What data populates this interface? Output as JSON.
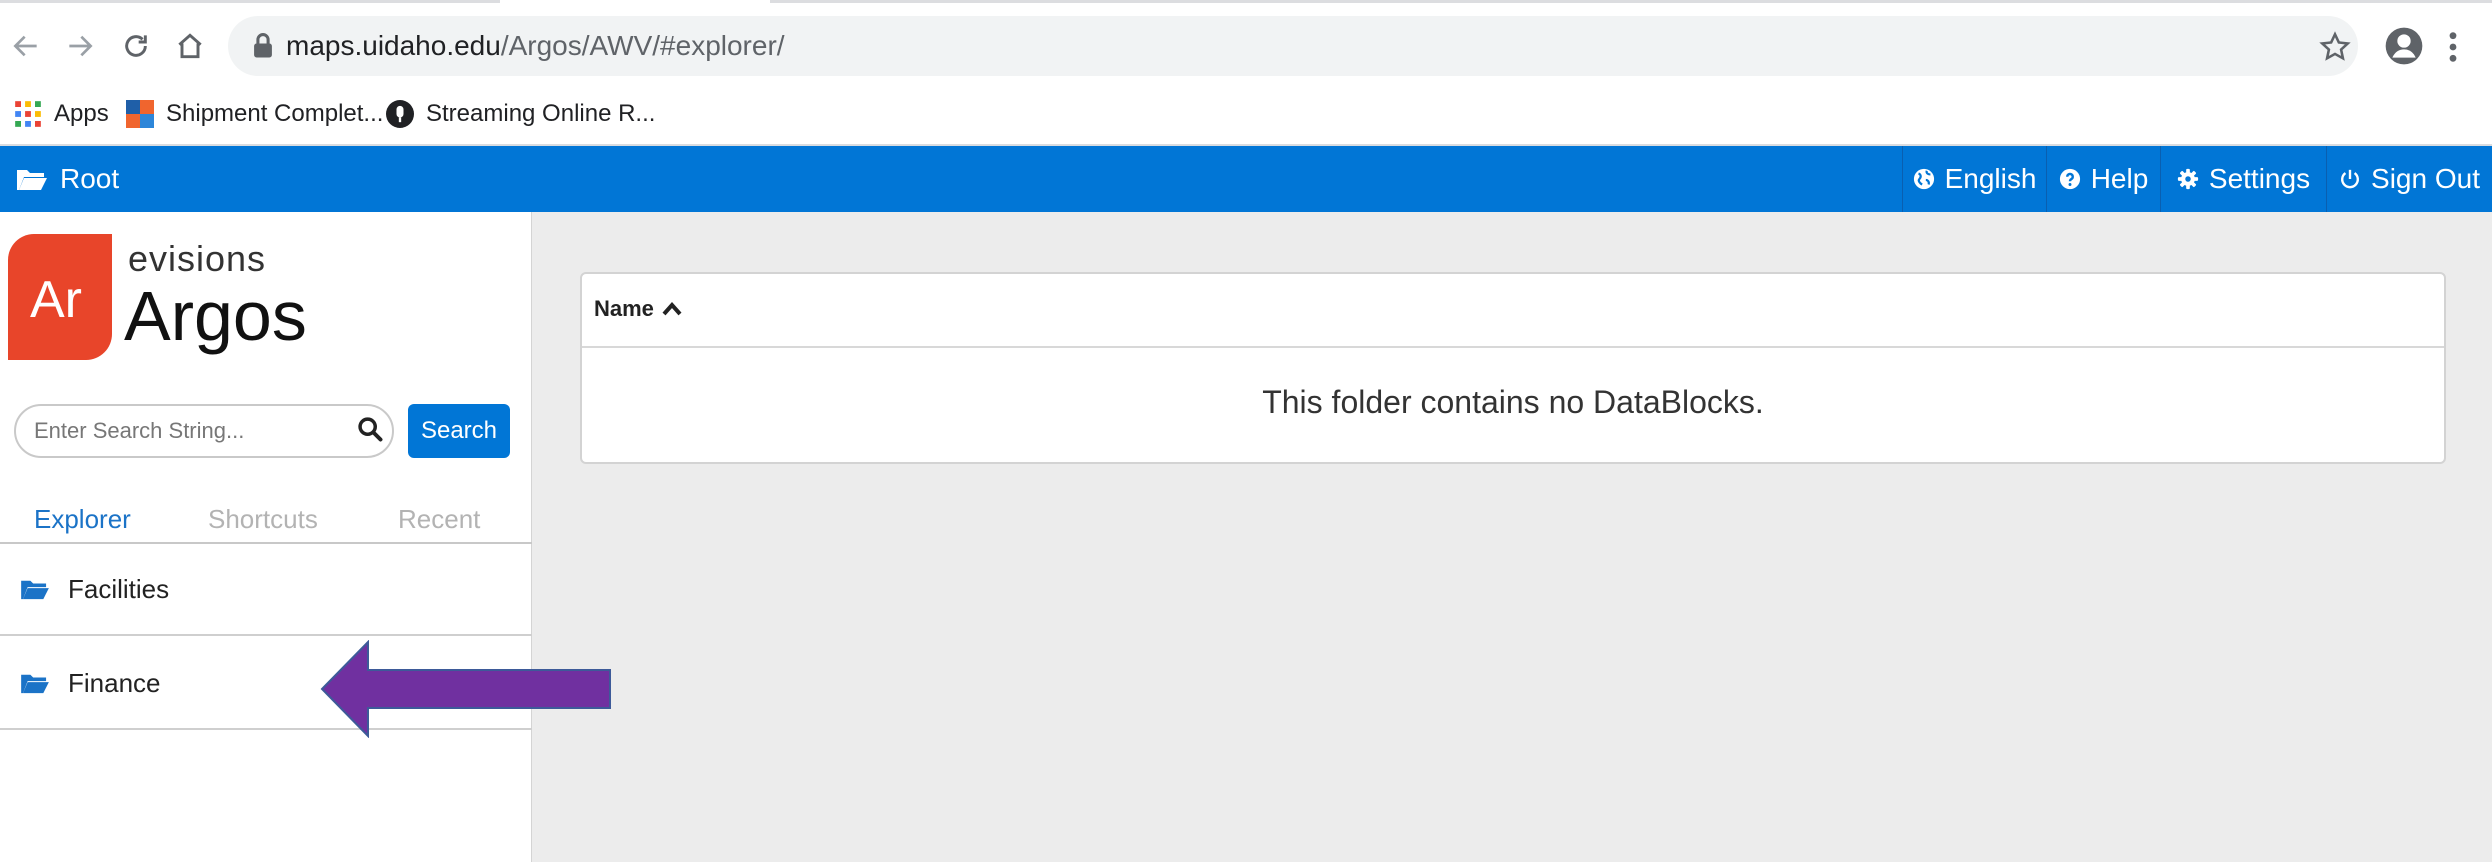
{
  "browser": {
    "url_host": "maps.uidaho.edu",
    "url_path": "/Argos/AWV/#explorer/",
    "bookmarks": [
      {
        "label": "Apps",
        "icon": "apps-grid-icon"
      },
      {
        "label": "Shipment Complet...",
        "icon": "shipment-site-icon"
      },
      {
        "label": "Streaming Online R...",
        "icon": "microphone-site-icon"
      }
    ]
  },
  "header": {
    "breadcrumb": "Root",
    "language": "English",
    "help": "Help",
    "settings": "Settings",
    "sign_out": "Sign Out"
  },
  "sidebar": {
    "brand_small": "evisions",
    "brand_big": "Argos",
    "logo_text": "Ar",
    "search_placeholder": "Enter Search String...",
    "search_button": "Search",
    "tabs": [
      {
        "label": "Explorer",
        "active": true
      },
      {
        "label": "Shortcuts",
        "active": false
      },
      {
        "label": "Recent",
        "active": false
      }
    ],
    "folders": [
      {
        "label": "Facilities"
      },
      {
        "label": "Finance"
      }
    ]
  },
  "main": {
    "column_header": "Name",
    "empty_message": "This folder contains no DataBlocks."
  },
  "colors": {
    "accent_blue": "#0176d6",
    "logo_red": "#e8452a",
    "annotation_arrow": "#7030a0",
    "content_bg": "#ececec"
  }
}
